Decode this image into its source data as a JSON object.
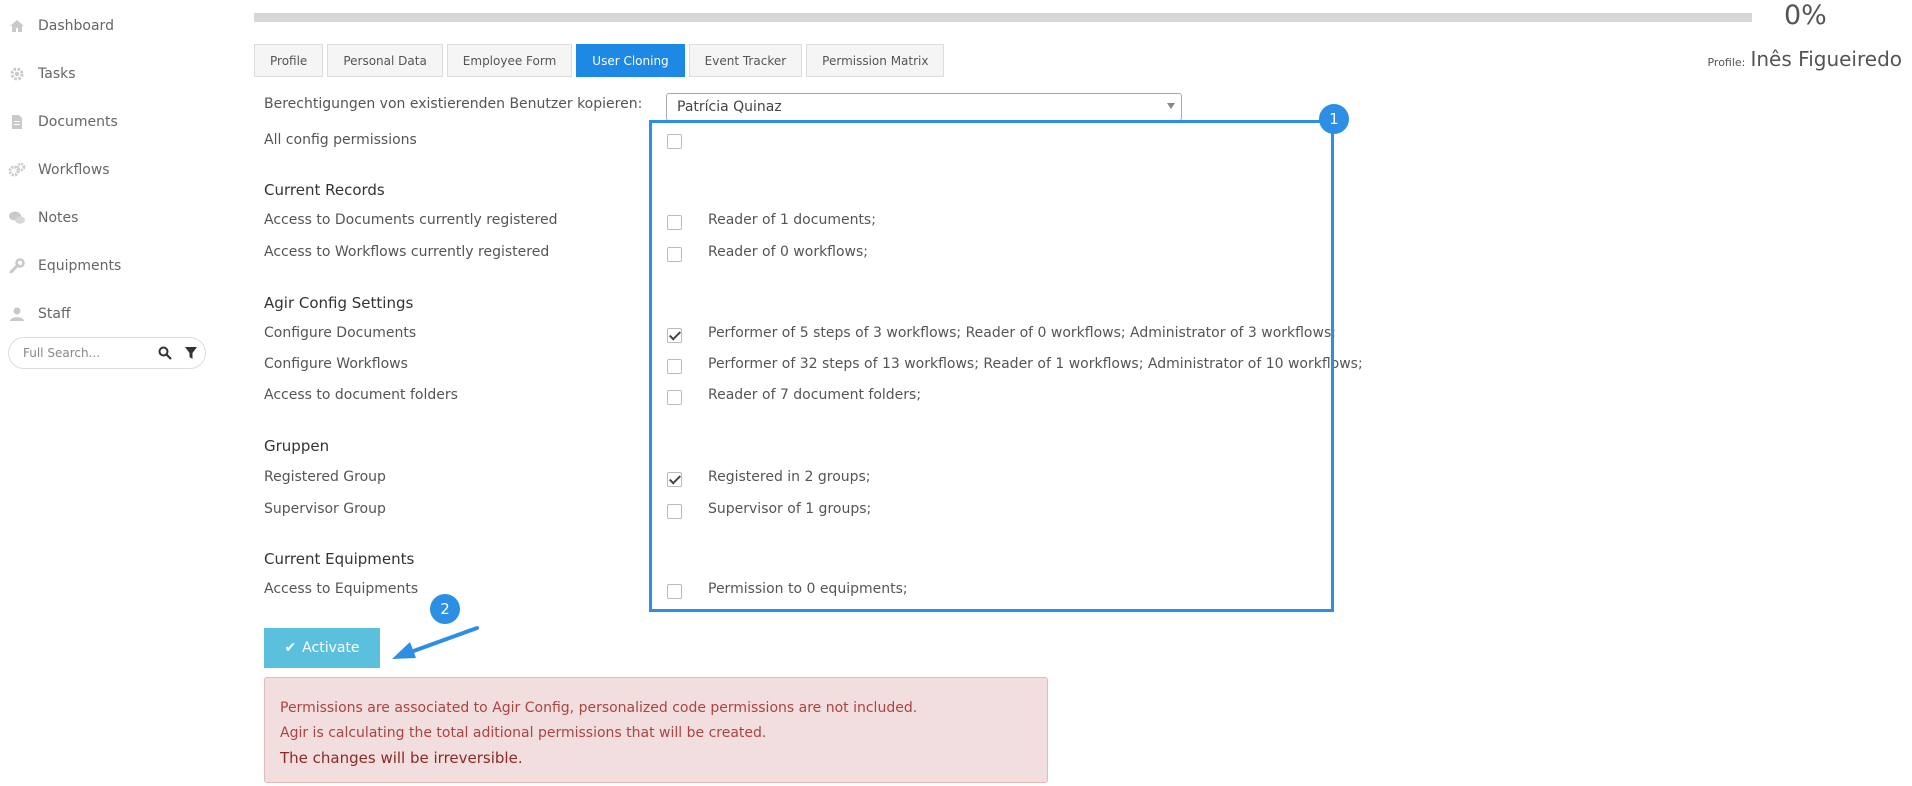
{
  "sidebar": {
    "items": [
      {
        "label": "Dashboard",
        "icon": "home-icon"
      },
      {
        "label": "Tasks",
        "icon": "gear-icon"
      },
      {
        "label": "Documents",
        "icon": "document-icon"
      },
      {
        "label": "Workflows",
        "icon": "gears-icon"
      },
      {
        "label": "Notes",
        "icon": "chat-bubbles-icon"
      },
      {
        "label": "Equipments",
        "icon": "wrench-icon"
      },
      {
        "label": "Staff",
        "icon": "user-icon"
      }
    ],
    "search": {
      "placeholder": "Full Search..."
    }
  },
  "progress": {
    "percent_text": "0%",
    "value": 0
  },
  "profile": {
    "label": "Profile:",
    "name": "Inês Figueiredo"
  },
  "tabs": [
    {
      "label": "Profile"
    },
    {
      "label": "Personal Data"
    },
    {
      "label": "Employee Form"
    },
    {
      "label": "User Cloning",
      "active": true
    },
    {
      "label": "Event Tracker"
    },
    {
      "label": "Permission Matrix"
    }
  ],
  "form": {
    "copy_label": "Berechtigungen von existierenden Benutzer kopieren:",
    "copy_value": "Patrícia Quinaz",
    "all_config_label": "All config permissions",
    "sections": {
      "current_records": "Current Records",
      "agir_config": "Agir Config Settings",
      "gruppen": "Gruppen",
      "current_equipments": "Current Equipments"
    },
    "rows": {
      "docs_registered": {
        "label": "Access to Documents currently registered",
        "desc": "Reader of 1 documents;",
        "checked": false
      },
      "wf_registered": {
        "label": "Access to Workflows currently registered",
        "desc": "Reader of 0 workflows;",
        "checked": false
      },
      "configure_docs": {
        "label": "Configure Documents",
        "desc": "Performer of 5 steps of 3 workflows; Reader of 0 workflows; Administrator of 3 workflows;",
        "checked": true
      },
      "configure_wf": {
        "label": "Configure Workflows",
        "desc": "Performer of 32 steps of 13 workflows; Reader of 1 workflows; Administrator of 10 workflows;",
        "checked": false
      },
      "doc_folders": {
        "label": "Access to document folders",
        "desc": "Reader of 7 document folders;",
        "checked": false
      },
      "registered_group": {
        "label": "Registered Group",
        "desc": "Registered in 2 groups;",
        "checked": true
      },
      "supervisor_group": {
        "label": "Supervisor Group",
        "desc": "Supervisor of 1 groups;",
        "checked": false
      },
      "equipments": {
        "label": "Access to Equipments",
        "desc": "Permission to 0 equipments;",
        "checked": false
      }
    }
  },
  "annotations": {
    "badge1": "1",
    "badge2": "2",
    "accent_color": "#2d8ee5"
  },
  "button": {
    "activate_label": "Activate"
  },
  "alert": {
    "line1": "Permissions are associated to Agir Config, personalized code permissions are not included.",
    "line2": "Agir is calculating the total aditional permissions that will be created.",
    "line3": "The changes will be irreversible."
  }
}
